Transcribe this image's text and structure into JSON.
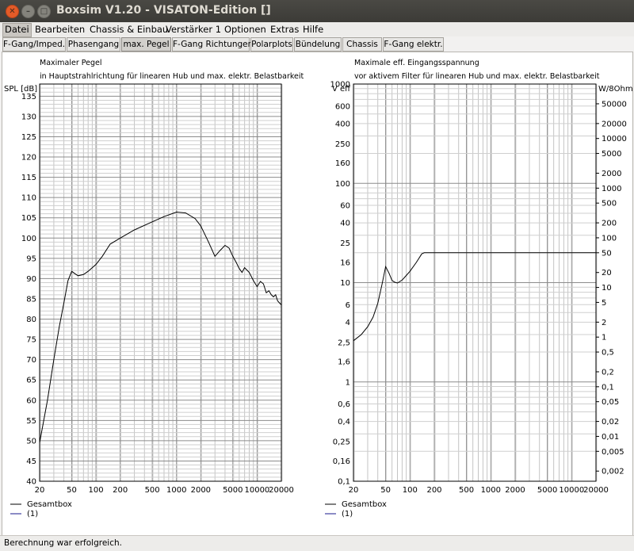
{
  "window": {
    "title": "Boxsim V1.20 - VISATON-Edition []"
  },
  "menu": [
    "Datei",
    "Bearbeiten",
    "Chassis & Einbau",
    "Verstärker 1",
    "Optionen",
    "Extras",
    "Hilfe"
  ],
  "tabs": [
    "F-Gang/Imped.",
    "Phasengang",
    "max. Pegel",
    "F-Gang Richtungen",
    "Polarplots",
    "Bündelung",
    "Chassis",
    "F-Gang elektr."
  ],
  "active_tab": "max. Pegel",
  "status": "Berechnung war erfolgreich.",
  "chart_data": [
    {
      "type": "line",
      "title": "Maximaler Pegel",
      "subtitle": "in Hauptstrahlrichtung für linearen Hub und max. elektr. Belastbarkeit",
      "ylabel": "SPL [dB]",
      "x_scale": "log",
      "xlim": [
        20,
        20000
      ],
      "ylim": [
        40,
        138
      ],
      "x_ticks": [
        "20",
        "50",
        "100",
        "200",
        "500",
        "1000",
        "2000",
        "5000",
        "10000",
        "20000"
      ],
      "y_ticks": [
        "40",
        "45",
        "50",
        "55",
        "60",
        "65",
        "70",
        "75",
        "80",
        "85",
        "90",
        "95",
        "100",
        "105",
        "110",
        "115",
        "120",
        "125",
        "130",
        "135"
      ],
      "grid": true,
      "legend": [
        "Gesamtbox",
        "(1)"
      ],
      "series": [
        {
          "name": "Gesamtbox",
          "color": "#000000",
          "x": [
            20,
            25,
            30,
            35,
            40,
            45,
            50,
            55,
            60,
            70,
            80,
            100,
            120,
            150,
            200,
            300,
            500,
            700,
            1000,
            1300,
            1700,
            2000,
            2500,
            3000,
            3500,
            4000,
            4500,
            5000,
            5500,
            6000,
            6500,
            7000,
            8000,
            9000,
            10000,
            11000,
            12000,
            13000,
            14000,
            15000,
            16000,
            17000,
            18000,
            19000,
            20000
          ],
          "y": [
            49.5,
            60,
            70,
            78,
            84,
            89.5,
            91.8,
            91.2,
            90.7,
            91,
            91.8,
            93.5,
            95.5,
            98.5,
            100,
            102,
            104,
            105.3,
            106.4,
            106.2,
            104.8,
            103,
            99,
            95.5,
            97,
            98.2,
            97.5,
            95.5,
            94,
            92.5,
            91.5,
            92.7,
            91.5,
            89.5,
            88,
            89.3,
            88.7,
            86.5,
            87,
            86,
            85.5,
            86,
            84.5,
            84,
            83.5
          ]
        }
      ]
    },
    {
      "type": "line",
      "title": "Maximale eff. Eingangsspannung",
      "subtitle": "vor aktivem Filter für linearen Hub und max. elektr. Belastbarkeit",
      "ylabel": "V eff",
      "ylabel_right": "W/8Ohm",
      "x_scale": "log",
      "y_scale": "log",
      "xlim": [
        20,
        20000
      ],
      "ylim": [
        0.1,
        1000
      ],
      "x_ticks": [
        "20",
        "50",
        "100",
        "200",
        "500",
        "1000",
        "2000",
        "5000",
        "10000",
        "20000"
      ],
      "y_ticks": [
        "0,1",
        "0,16",
        "0,25",
        "0,4",
        "0,6",
        "1",
        "1,6",
        "2,5",
        "4",
        "6",
        "10",
        "16",
        "25",
        "40",
        "60",
        "100",
        "160",
        "250",
        "400",
        "600",
        "1000"
      ],
      "y_ticks_right": [
        "50000",
        "20000",
        "10000",
        "5000",
        "2000",
        "1000",
        "500",
        "200",
        "100",
        "50",
        "20",
        "10",
        "5",
        "2",
        "1",
        "0,5",
        "0,2",
        "0,1",
        "0,05",
        "0,02",
        "0,01",
        "0,005",
        "0,002"
      ],
      "grid": true,
      "legend": [
        "Gesamtbox",
        "(1)"
      ],
      "series": [
        {
          "name": "Gesamtbox",
          "color": "#000000",
          "x": [
            20,
            25,
            30,
            35,
            40,
            45,
            50,
            55,
            60,
            65,
            70,
            80,
            90,
            100,
            120,
            140,
            150,
            200,
            500,
            1000,
            5000,
            20000
          ],
          "y": [
            2.6,
            3,
            3.6,
            4.5,
            6.2,
            9.5,
            14.5,
            12.5,
            10.5,
            10.1,
            9.9,
            10.6,
            11.8,
            13,
            16,
            19.5,
            20,
            20,
            20,
            20,
            20,
            20
          ]
        }
      ]
    }
  ]
}
